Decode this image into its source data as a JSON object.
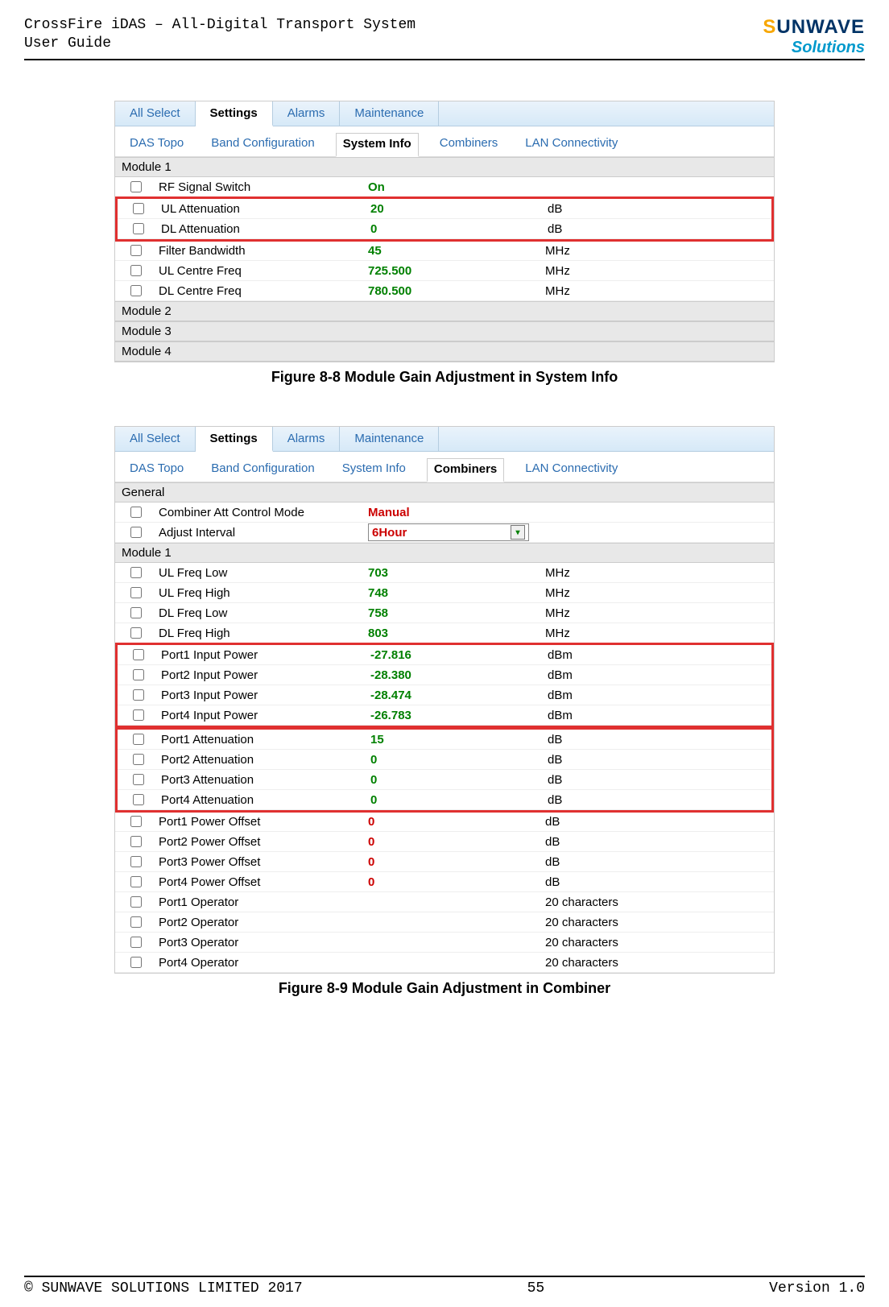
{
  "header": {
    "title1": "CrossFire iDAS – All-Digital Transport System",
    "title2": "User Guide",
    "logo_top_pre": "S",
    "logo_top_sun": "UN",
    "logo_top_post": "WAVE",
    "logo_bottom": "Solutions"
  },
  "fig1": {
    "top_tabs": {
      "all_select": "All Select",
      "settings": "Settings",
      "alarms": "Alarms",
      "maintenance": "Maintenance"
    },
    "sub_tabs": {
      "das_topo": "DAS Topo",
      "band_config": "Band Configuration",
      "system_info": "System Info",
      "combiners": "Combiners",
      "lan": "LAN Connectivity"
    },
    "sections": {
      "module1": "Module 1",
      "module2": "Module 2",
      "module3": "Module 3",
      "module4": "Module 4"
    },
    "rows": {
      "rf_switch": {
        "label": "RF Signal Switch",
        "value": "On",
        "unit": ""
      },
      "ul_att": {
        "label": "UL Attenuation",
        "value": "20",
        "unit": "dB"
      },
      "dl_att": {
        "label": "DL Attenuation",
        "value": "0",
        "unit": "dB"
      },
      "filter_bw": {
        "label": "Filter Bandwidth",
        "value": "45",
        "unit": "MHz"
      },
      "ul_centre": {
        "label": "UL Centre Freq",
        "value": "725.500",
        "unit": "MHz"
      },
      "dl_centre": {
        "label": "DL Centre Freq",
        "value": "780.500",
        "unit": "MHz"
      }
    },
    "caption": "Figure 8-8 Module Gain Adjustment in System Info"
  },
  "fig2": {
    "top_tabs": {
      "all_select": "All Select",
      "settings": "Settings",
      "alarms": "Alarms",
      "maintenance": "Maintenance"
    },
    "sub_tabs": {
      "das_topo": "DAS Topo",
      "band_config": "Band Configuration",
      "system_info": "System Info",
      "combiners": "Combiners",
      "lan": "LAN Connectivity"
    },
    "sections": {
      "general": "General",
      "module1": "Module 1"
    },
    "rows": {
      "ctrl_mode": {
        "label": "Combiner Att Control Mode",
        "value": "Manual",
        "unit": ""
      },
      "adj_int": {
        "label": "Adjust Interval",
        "value": "6Hour",
        "unit": ""
      },
      "ul_low": {
        "label": "UL Freq Low",
        "value": "703",
        "unit": "MHz"
      },
      "ul_high": {
        "label": "UL Freq High",
        "value": "748",
        "unit": "MHz"
      },
      "dl_low": {
        "label": "DL Freq Low",
        "value": "758",
        "unit": "MHz"
      },
      "dl_high": {
        "label": "DL Freq High",
        "value": "803",
        "unit": "MHz"
      },
      "p1_in": {
        "label": "Port1 Input Power",
        "value": "-27.816",
        "unit": "dBm"
      },
      "p2_in": {
        "label": "Port2 Input Power",
        "value": "-28.380",
        "unit": "dBm"
      },
      "p3_in": {
        "label": "Port3 Input Power",
        "value": "-28.474",
        "unit": "dBm"
      },
      "p4_in": {
        "label": "Port4 Input Power",
        "value": "-26.783",
        "unit": "dBm"
      },
      "p1_att": {
        "label": "Port1 Attenuation",
        "value": "15",
        "unit": "dB"
      },
      "p2_att": {
        "label": "Port2 Attenuation",
        "value": "0",
        "unit": "dB"
      },
      "p3_att": {
        "label": "Port3 Attenuation",
        "value": "0",
        "unit": "dB"
      },
      "p4_att": {
        "label": "Port4 Attenuation",
        "value": "0",
        "unit": "dB"
      },
      "p1_off": {
        "label": "Port1 Power Offset",
        "value": "0",
        "unit": "dB"
      },
      "p2_off": {
        "label": "Port2 Power Offset",
        "value": "0",
        "unit": "dB"
      },
      "p3_off": {
        "label": "Port3 Power Offset",
        "value": "0",
        "unit": "dB"
      },
      "p4_off": {
        "label": "Port4 Power Offset",
        "value": "0",
        "unit": "dB"
      },
      "p1_op": {
        "label": "Port1 Operator",
        "value": "",
        "unit": "20 characters"
      },
      "p2_op": {
        "label": "Port2 Operator",
        "value": "",
        "unit": "20 characters"
      },
      "p3_op": {
        "label": "Port3 Operator",
        "value": "",
        "unit": "20 characters"
      },
      "p4_op": {
        "label": "Port4 Operator",
        "value": "",
        "unit": "20 characters"
      }
    },
    "caption": "Figure 8-9 Module Gain Adjustment in Combiner"
  },
  "footer": {
    "copyright": "© SUNWAVE SOLUTIONS LIMITED 2017",
    "page": "55",
    "version": "Version 1.0"
  }
}
